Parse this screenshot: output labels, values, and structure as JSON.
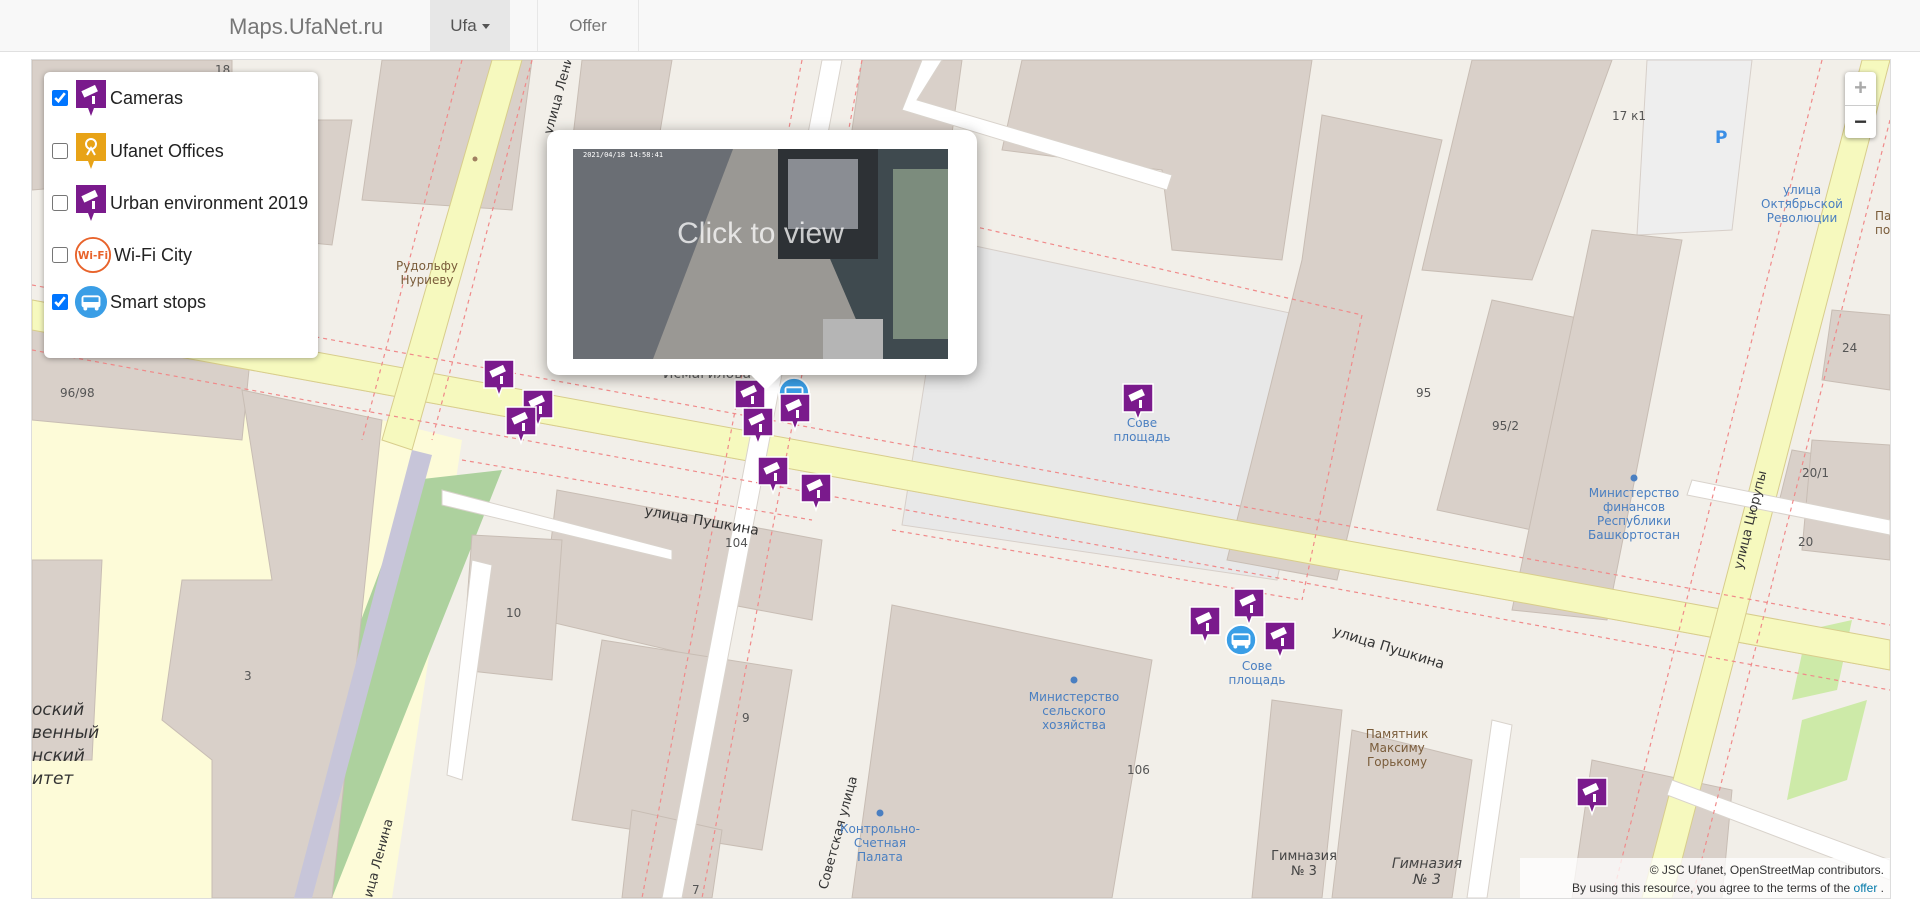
{
  "navbar": {
    "brand": "Maps.UfaNet.ru",
    "city": "Ufa",
    "offer": "Offer"
  },
  "layers": [
    {
      "label": "Cameras",
      "checked": true,
      "icon": "camera-marker-icon"
    },
    {
      "label": "Ufanet Offices",
      "checked": false,
      "icon": "office-marker-icon"
    },
    {
      "label": "Urban environment 2019",
      "checked": false,
      "icon": "camera-marker-icon"
    },
    {
      "label": "Wi-Fi City",
      "checked": false,
      "icon": "wifi-city-icon"
    },
    {
      "label": "Smart stops",
      "checked": true,
      "icon": "bus-stop-icon"
    }
  ],
  "layer_icon_text": {
    "wifi": "Wi-Fi"
  },
  "zoom": {
    "in": "+",
    "out": "−"
  },
  "popup": {
    "label": "Click to view",
    "timestamp": "2021/04/18 14:58:41"
  },
  "map_labels": {
    "pushkina_1": "улица Пушкина",
    "pushkina_2": "улица Пушкина",
    "lenina_top": "улица Ленина",
    "lenina_bottom": "ица Ленина",
    "sovetskaya": "Советская улица",
    "tsyurupy": "улица Цюрупы",
    "oktyabr_1": "улица",
    "oktyabr_2": "Октябрьской",
    "oktyabr_3": "Революции",
    "nureev_1": "Рудольфу",
    "nureev_2": "Нуриеву",
    "ismagil": "Исмагилова",
    "sov_sq_1": "Сове",
    "sov_sq_2": "площадь",
    "sov_sq2_1": "Сове",
    "sov_sq2_2": "площадь",
    "minfin_1": "Министерство",
    "minfin_2": "финансов",
    "minfin_3": "Республики",
    "minfin_4": "Башкортостан",
    "minsh_1": "Министерство",
    "minsh_2": "сельского",
    "minsh_3": "хозяйства",
    "gorky_1": "Памятник",
    "gorky_2": "Максиму",
    "gorky_3": "Горькому",
    "kontrol_1": "Контрольно-",
    "kontrol_2": "Счетная",
    "kontrol_3": "Палата",
    "gym_1": "Гимназия",
    "gym_2": "№ 3",
    "gym_italic_1": "Гимназия",
    "gym_italic_2": "№ 3",
    "univ_1": "оский",
    "univ_2": "венный",
    "univ_3": "нский",
    "univ_4": "итет",
    "h18": "18",
    "h17k1": "17 к1",
    "h96_98": "96/98",
    "h95": "95",
    "h95_2": "95/2",
    "h24": "24",
    "h20_1": "20/1",
    "h20": "20",
    "h104": "104",
    "h10": "10",
    "h3": "3",
    "h9": "9",
    "h106": "106",
    "h7": "7",
    "parking": "P",
    "pa": "Па",
    "po": "по"
  },
  "attribution": {
    "line1": "© JSC Ufanet, OpenStreetMap contributors.",
    "line2_prefix": "By using this resource, you agree to the terms of the",
    "link": "offer",
    "line2_suffix": "."
  },
  "colors": {
    "camera_marker": "#7a1a8c",
    "office_marker": "#e8a317",
    "wifi_marker": "#e8632b",
    "bus_marker": "#3a9ee6",
    "road_yellow": "#f6f9be",
    "road_white": "#ffffff",
    "building": "#d9d0c9",
    "square": "#e8e8e8",
    "park": "#add19e",
    "map_link": "#0078a8"
  }
}
